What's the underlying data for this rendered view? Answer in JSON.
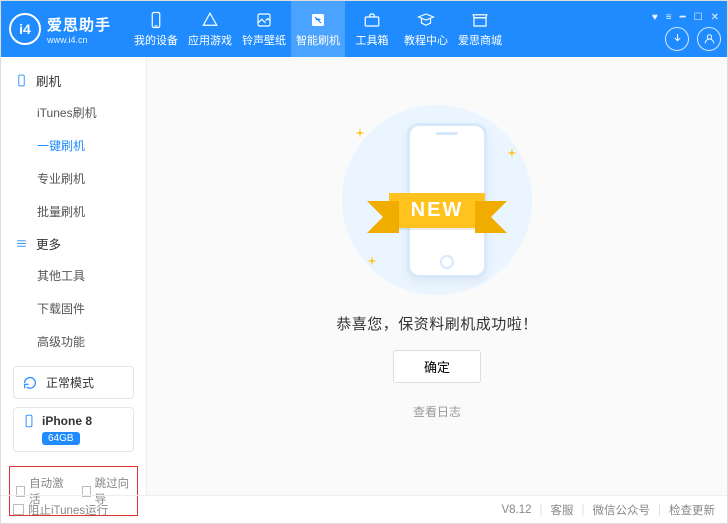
{
  "brand": {
    "title": "爱思助手",
    "site": "www.i4.cn",
    "mark": "i4"
  },
  "nav": {
    "items": [
      {
        "label": "我的设备"
      },
      {
        "label": "应用游戏"
      },
      {
        "label": "铃声壁纸"
      },
      {
        "label": "智能刷机"
      },
      {
        "label": "工具箱"
      },
      {
        "label": "教程中心"
      },
      {
        "label": "爱思商城"
      }
    ],
    "activeIndex": 3
  },
  "sidebar": {
    "group1": {
      "title": "刷机",
      "items": [
        "iTunes刷机",
        "一键刷机",
        "专业刷机",
        "批量刷机"
      ],
      "activeIndex": 1
    },
    "group2": {
      "title": "更多",
      "items": [
        "其他工具",
        "下载固件",
        "高级功能"
      ]
    },
    "mode": "正常模式",
    "device": {
      "name": "iPhone 8",
      "capacity": "64GB"
    },
    "checks": {
      "auto": "自动激活",
      "skip": "跳过向导"
    }
  },
  "main": {
    "banner": "NEW",
    "message": "恭喜您，保资料刷机成功啦！",
    "ok": "确定",
    "log": "查看日志"
  },
  "footer": {
    "block": "阻止iTunes运行",
    "version": "V8.12",
    "support": "客服",
    "wechat": "微信公众号",
    "update": "检查更新"
  }
}
